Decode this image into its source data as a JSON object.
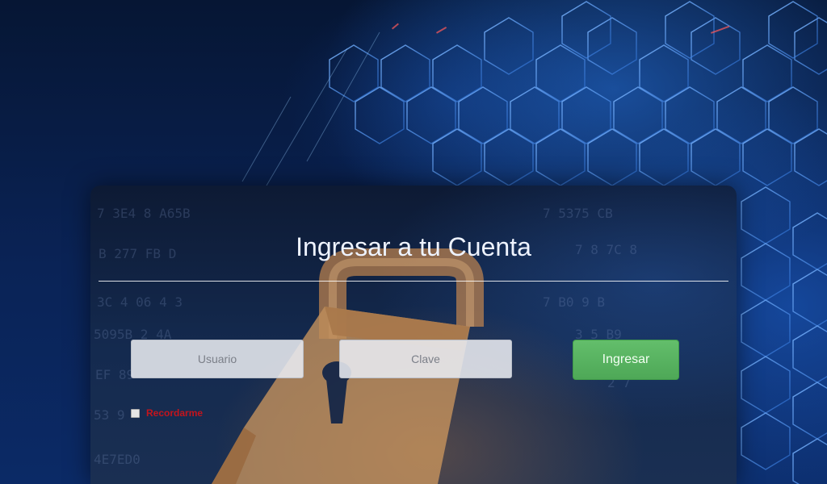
{
  "login": {
    "title": "Ingresar a tu Cuenta",
    "username_placeholder": "Usuario",
    "username_value": "",
    "password_placeholder": "Clave",
    "password_value": "",
    "submit_label": "Ingresar",
    "remember_label": "Recordarme",
    "remember_checked": false
  },
  "colors": {
    "background": "#071a3d",
    "accent_blue": "#2a7ae8",
    "button_green": "#5cb85c",
    "remember_red": "#c4141c",
    "title_text": "#eef3ff"
  },
  "icons": {
    "background_art": "padlock-icon"
  }
}
